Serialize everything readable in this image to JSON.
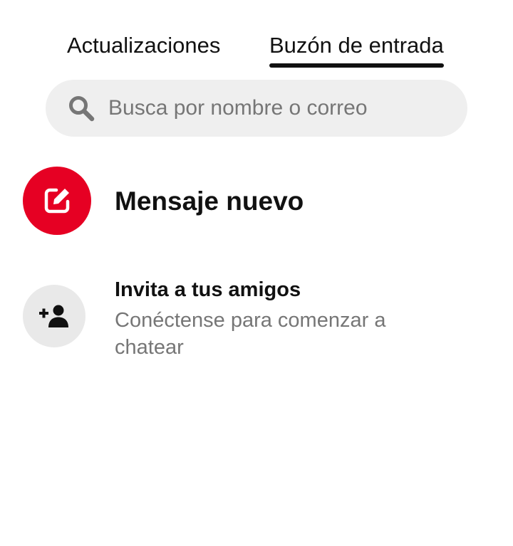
{
  "tabs": {
    "updates": "Actualizaciones",
    "inbox": "Buzón de entrada",
    "active": "inbox"
  },
  "search": {
    "placeholder": "Busca por nombre o correo",
    "icon": "search-icon"
  },
  "new_message": {
    "label": "Mensaje nuevo",
    "icon": "edit-icon",
    "color": "#e60023"
  },
  "invite": {
    "title": "Invita a tus amigos",
    "subtitle": "Conéctense para comenzar a chatear",
    "icon": "add-person-icon"
  }
}
